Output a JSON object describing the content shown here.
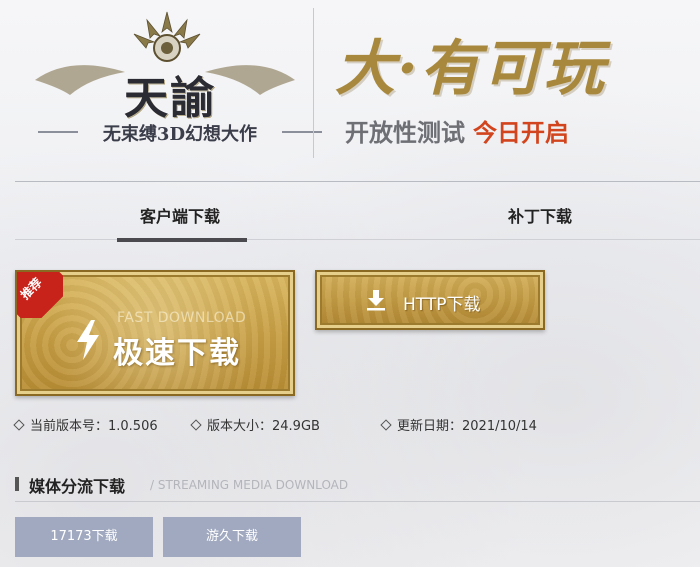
{
  "header": {
    "logo_title": "天諭",
    "logo_subtitle": "无束缚3D幻想大作",
    "slogan": "大·有可玩",
    "test_label": "开放性测试",
    "test_highlight": "今日开启"
  },
  "tabs": [
    {
      "label": "客户端下载",
      "active": true
    },
    {
      "label": "补丁下载",
      "active": false
    }
  ],
  "fast_download": {
    "badge": "推荐",
    "en_label": "FAST DOWNLOAD",
    "cn_label": "极速下载",
    "icon": "lightning-icon"
  },
  "http_download": {
    "label": "HTTP下载",
    "icon": "download-icon"
  },
  "info": {
    "version": "当前版本号：1.0.506",
    "size": "版本大小：24.9GB",
    "date": "更新日期：2021/10/14"
  },
  "media": {
    "title": "媒体分流下载",
    "subtitle": "/ STREAMING MEDIA DOWNLOAD",
    "buttons": [
      {
        "label": "17173下载"
      },
      {
        "label": "游久下载"
      }
    ]
  },
  "colors": {
    "gold": "#c9a046",
    "red_accent": "#d2441d",
    "badge_red": "#c8231b",
    "media_button": "#a0a9c0"
  }
}
